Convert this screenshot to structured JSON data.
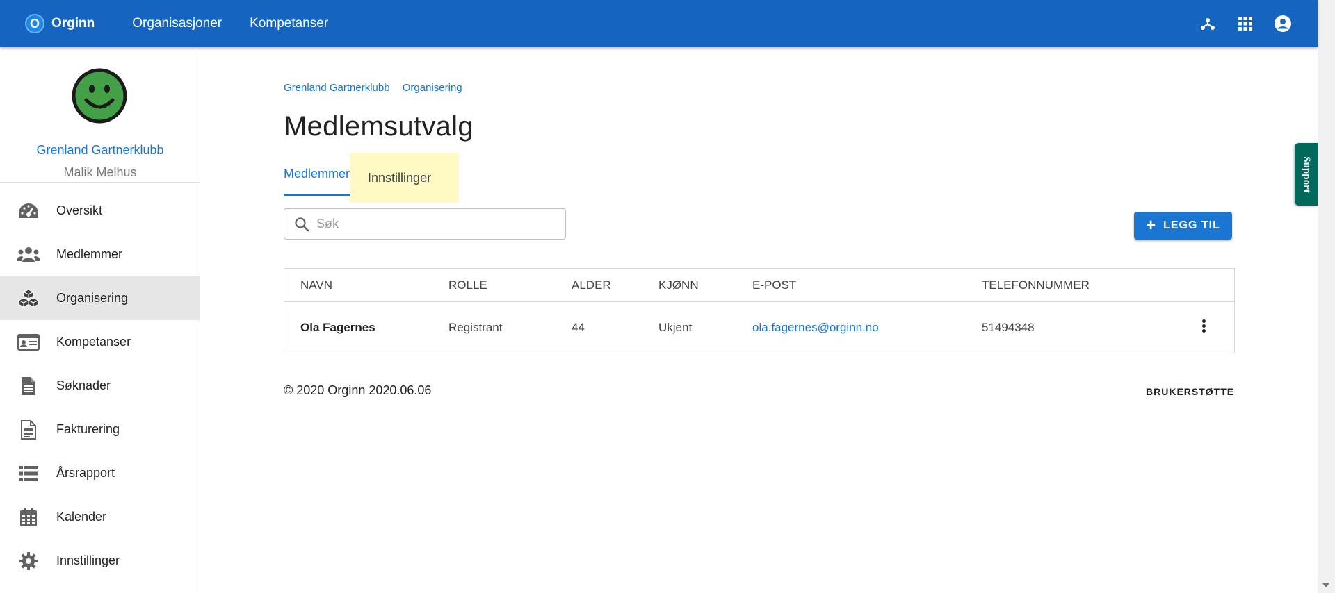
{
  "topbar": {
    "logo_letter": "O",
    "brand": "Orginn",
    "nav": [
      "Organisasjoner",
      "Kompetanser"
    ],
    "icons": [
      "hierarchy-icon",
      "apps-grid-icon",
      "account-circle-icon"
    ]
  },
  "sidebar": {
    "org_name": "Grenland Gartnerklubb",
    "user_name": "Malik Melhus",
    "items": [
      {
        "label": "Oversikt",
        "icon": "dashboard-gauge-icon"
      },
      {
        "label": "Medlemmer",
        "icon": "people-icon"
      },
      {
        "label": "Organisering",
        "icon": "cubes-icon",
        "active": true
      },
      {
        "label": "Kompetanser",
        "icon": "id-card-icon"
      },
      {
        "label": "Søknader",
        "icon": "document-icon"
      },
      {
        "label": "Fakturering",
        "icon": "invoice-icon"
      },
      {
        "label": "Årsrapport",
        "icon": "list-icon"
      },
      {
        "label": "Kalender",
        "icon": "calendar-icon"
      },
      {
        "label": "Innstillinger",
        "icon": "gear-icon"
      }
    ]
  },
  "main": {
    "breadcrumb": [
      "Grenland Gartnerklubb",
      "Organisering"
    ],
    "title": "Medlemsutvalg",
    "tabs": [
      "Medlemmer",
      "Innstillinger"
    ],
    "search_placeholder": "Søk",
    "add_button": "LEGG TIL",
    "table": {
      "headers": [
        "NAVN",
        "ROLLE",
        "ALDER",
        "KJØNN",
        "E-POST",
        "TELEFONNUMMER"
      ],
      "rows": [
        {
          "navn": "Ola Fagernes",
          "rolle": "Registrant",
          "alder": "44",
          "kjonn": "Ukjent",
          "epost": "ola.fagernes@orginn.no",
          "telefon": "51494348"
        }
      ]
    },
    "footer_left": "© 2020 Orginn 2020.06.06",
    "footer_right": "BRUKERSTØTTE"
  },
  "support_tab": "Support",
  "colors": {
    "primary": "#1565c0",
    "accent": "#1976d2",
    "support": "#00695c",
    "tab_highlight": "#fff9c4",
    "avatar": "#43a047"
  }
}
